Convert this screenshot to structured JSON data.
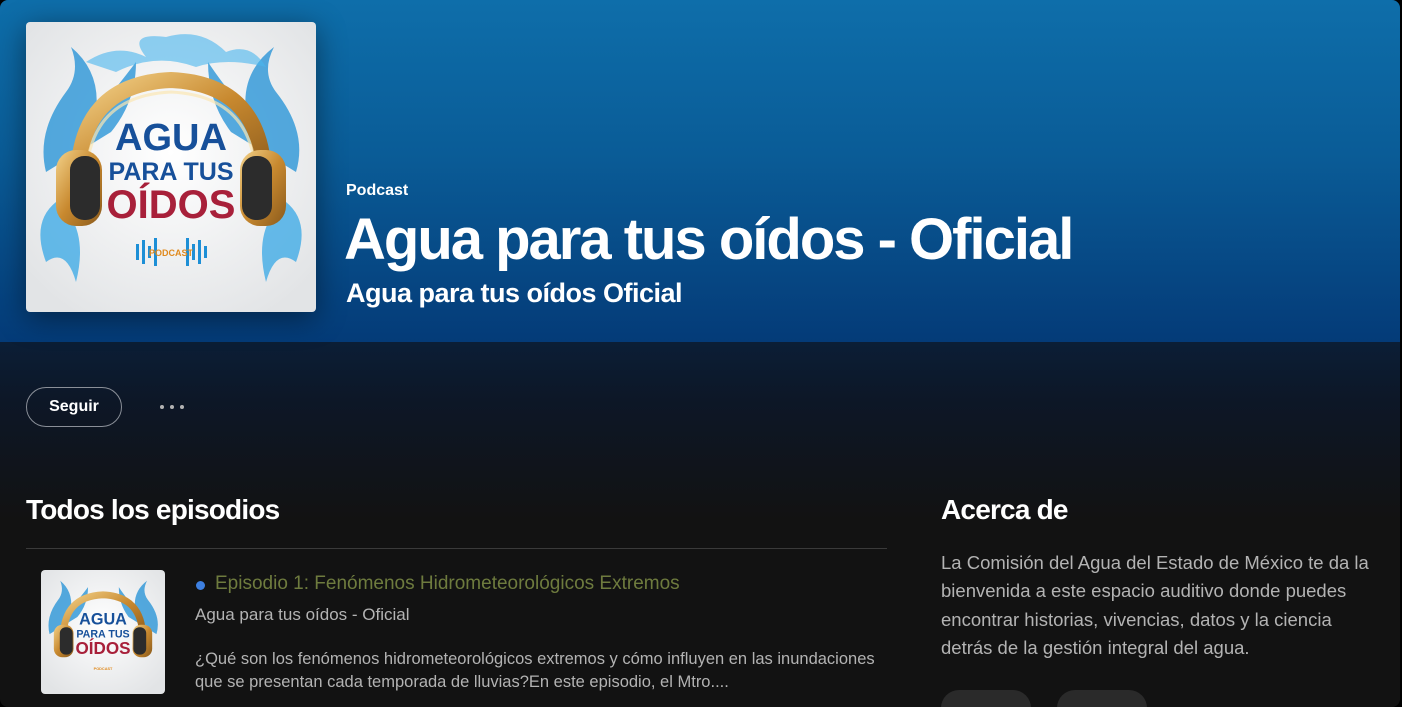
{
  "hero": {
    "type_label": "Podcast",
    "title": "Agua para tus oídos - Oficial",
    "author": "Agua para tus oídos Oficial"
  },
  "cover_art": {
    "line1": "AGUA",
    "line2": "PARA TUS",
    "line3": "OÍDOS",
    "badge": "PODCAST"
  },
  "actions": {
    "follow_label": "Seguir",
    "more_icon": "more-horizontal-icon"
  },
  "episodes_section": {
    "title": "Todos los episodios",
    "episodes": [
      {
        "title": "Episodio 1: Fenómenos Hidrometeorológicos Extremos",
        "show": "Agua para tus oídos - Oficial",
        "description": "¿Qué son los fenómenos hidrometeorológicos extremos y cómo influyen en las inundaciones que se presentan cada temporada de lluvias?En este episodio, el Mtro...."
      }
    ]
  },
  "about_section": {
    "title": "Acerca de",
    "text": "La Comisión del Agua del Estado de México te da la bienvenida a este espacio auditivo donde puedes encontrar historias, vivencias, datos y la ciencia detrás de la gestión integral del agua."
  },
  "colors": {
    "hero_top": "#0e6eaa",
    "hero_bottom": "#043b78",
    "background": "#121212",
    "unplayed_dot": "#3d7fe0",
    "episode_title": "#6e7b3e"
  }
}
